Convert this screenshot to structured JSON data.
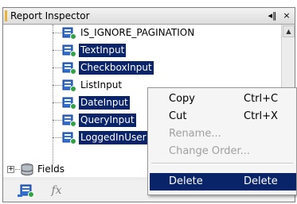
{
  "panel": {
    "title": "Report Inspector",
    "pin_glyph": "◂‖",
    "close_glyph": "×"
  },
  "tree": {
    "items": [
      {
        "label": "IS_IGNORE_PAGINATION",
        "selected": false,
        "icon": "parameter-icon"
      },
      {
        "label": "TextInput",
        "selected": true,
        "icon": "parameter-icon"
      },
      {
        "label": "CheckboxInput",
        "selected": true,
        "icon": "parameter-icon"
      },
      {
        "label": "ListInput",
        "selected": false,
        "icon": "parameter-icon"
      },
      {
        "label": "DateInput",
        "selected": true,
        "icon": "parameter-icon"
      },
      {
        "label": "QueryInput",
        "selected": true,
        "icon": "parameter-icon"
      },
      {
        "label": "LoggedInUser",
        "selected": true,
        "icon": "parameter-icon"
      }
    ],
    "fields": {
      "label": "Fields",
      "expander": "+",
      "icon": "database-icon"
    }
  },
  "scrollbar": {
    "up_glyph": "▲"
  },
  "toolbar": {
    "add_parameter_icon": "add-parameter-icon",
    "fx_label": "fx"
  },
  "context_menu": {
    "items": [
      {
        "label": "Copy",
        "accel": "Ctrl+C",
        "state": "enabled"
      },
      {
        "label": "Cut",
        "accel": "Ctrl+X",
        "state": "enabled"
      },
      {
        "label": "Rename...",
        "accel": "",
        "state": "disabled"
      },
      {
        "label": "Change Order...",
        "accel": "",
        "state": "disabled"
      },
      {
        "label": "Delete",
        "accel": "Delete",
        "state": "highlighted"
      }
    ]
  },
  "colors": {
    "selection": "#0a246a",
    "title_accent": "#e8b33a",
    "disabled_text": "#a0a0a0"
  }
}
